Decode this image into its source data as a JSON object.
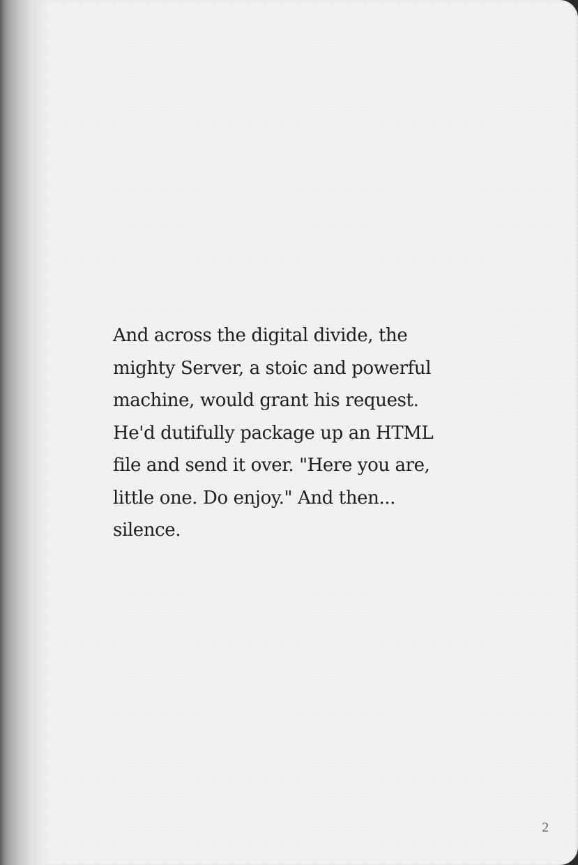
{
  "page": {
    "paragraph": "And across the digital divide, the\nmighty Server, a stoic and powerful\nmachine, would grant his request.\nHe'd dutifully package up an HTML\nfile and send it over. \"Here you are,\nlittle one. Do enjoy.\" And then...\nsilence.",
    "page_number": "2"
  },
  "colors": {
    "paper": "#f1f1f0",
    "text": "#1e1e1e",
    "page_number": "#555555"
  }
}
